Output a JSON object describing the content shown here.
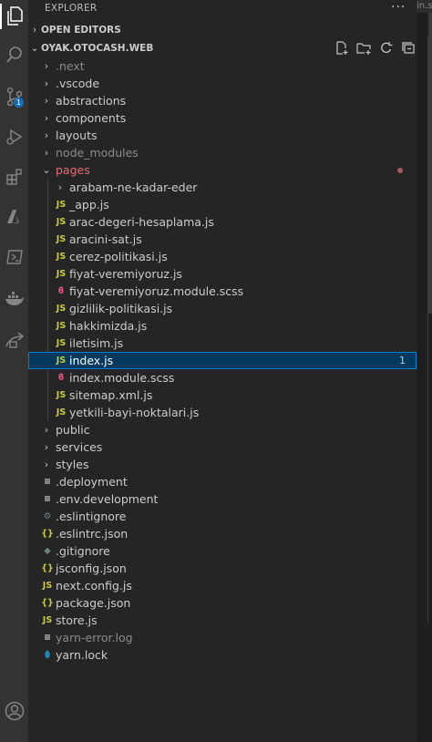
{
  "explorer": {
    "title": "EXPLORER",
    "more": "···",
    "open_editors": "OPEN EDITORS",
    "project": "OYAK.OTOCASH.WEB"
  },
  "activity_bar": {
    "items": [
      "files-icon",
      "search-icon",
      "source-control-icon",
      "run-debug-icon",
      "extensions-icon",
      "azure-icon",
      "terminal-icon",
      "docker-icon",
      "remote-icon",
      "account-icon"
    ],
    "source_control_badge": "1"
  },
  "editor_tab_fragment": "in.s",
  "tree": [
    {
      "name": ".next",
      "type": "folder",
      "dim": true
    },
    {
      "name": ".vscode",
      "type": "folder"
    },
    {
      "name": "abstractions",
      "type": "folder"
    },
    {
      "name": "components",
      "type": "folder"
    },
    {
      "name": "layouts",
      "type": "folder"
    },
    {
      "name": "node_modules",
      "type": "folder",
      "dim": true
    },
    {
      "name": "pages",
      "type": "folder",
      "open": true,
      "modified": true
    },
    {
      "name": "arabam-ne-kadar-eder",
      "type": "folder",
      "depth": 1
    },
    {
      "name": "_app.js",
      "type": "js",
      "depth": 1
    },
    {
      "name": "arac-degeri-hesaplama.js",
      "type": "js",
      "depth": 1
    },
    {
      "name": "aracini-sat.js",
      "type": "js",
      "depth": 1
    },
    {
      "name": "cerez-politikasi.js",
      "type": "js",
      "depth": 1
    },
    {
      "name": "fiyat-veremiyoruz.js",
      "type": "js",
      "depth": 1
    },
    {
      "name": "fiyat-veremiyoruz.module.scss",
      "type": "scss",
      "depth": 1
    },
    {
      "name": "gizlilik-politikasi.js",
      "type": "js",
      "depth": 1
    },
    {
      "name": "hakkimizda.js",
      "type": "js",
      "depth": 1
    },
    {
      "name": "iletisim.js",
      "type": "js",
      "depth": 1
    },
    {
      "name": "index.js",
      "type": "js",
      "depth": 1,
      "selected": true,
      "problems": "1"
    },
    {
      "name": "index.module.scss",
      "type": "scss",
      "depth": 1
    },
    {
      "name": "sitemap.xml.js",
      "type": "js",
      "depth": 1
    },
    {
      "name": "yetkili-bayi-noktalari.js",
      "type": "js",
      "depth": 1
    },
    {
      "name": "public",
      "type": "folder"
    },
    {
      "name": "services",
      "type": "folder"
    },
    {
      "name": "styles",
      "type": "folder"
    },
    {
      "name": ".deployment",
      "type": "text"
    },
    {
      "name": ".env.development",
      "type": "text"
    },
    {
      "name": ".eslintignore",
      "type": "gear"
    },
    {
      "name": ".eslintrc.json",
      "type": "json"
    },
    {
      "name": ".gitignore",
      "type": "diamond"
    },
    {
      "name": "jsconfig.json",
      "type": "json"
    },
    {
      "name": "next.config.js",
      "type": "js"
    },
    {
      "name": "package.json",
      "type": "json"
    },
    {
      "name": "store.js",
      "type": "js"
    },
    {
      "name": "yarn-error.log",
      "type": "text",
      "dim": true
    },
    {
      "name": "yarn.lock",
      "type": "yarn"
    }
  ],
  "glyphs": {
    "folder_closed": "›",
    "folder_open": "⌄",
    "js": "JS",
    "json": "{}",
    "scss": "ϐ",
    "text": "≡",
    "gear": "⚙",
    "diamond": "◆",
    "yarn": "⬮",
    "section": "›",
    "section_open": "⌄"
  }
}
